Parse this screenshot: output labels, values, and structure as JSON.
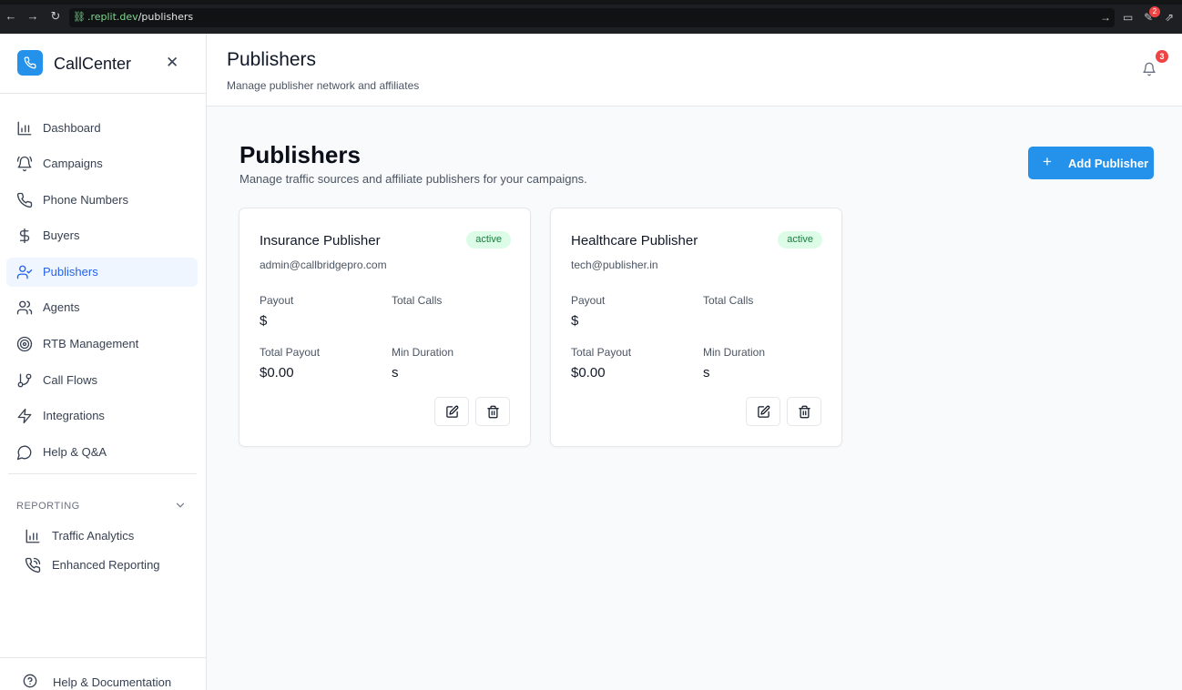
{
  "browser": {
    "url_domain": ".replit.dev",
    "url_path": "/publishers",
    "extension_badge": "2"
  },
  "sidebar": {
    "brand": "CallCenter",
    "close": "✕",
    "items": [
      {
        "label": "Dashboard",
        "icon": "bar-chart-icon"
      },
      {
        "label": "Campaigns",
        "icon": "bell-ring-icon"
      },
      {
        "label": "Phone Numbers",
        "icon": "phone-icon"
      },
      {
        "label": "Buyers",
        "icon": "dollar-icon"
      },
      {
        "label": "Publishers",
        "icon": "user-check-icon",
        "active": true
      },
      {
        "label": "Agents",
        "icon": "users-icon"
      },
      {
        "label": "RTB Management",
        "icon": "target-icon"
      },
      {
        "label": "Call Flows",
        "icon": "git-branch-icon"
      },
      {
        "label": "Integrations",
        "icon": "zap-icon"
      },
      {
        "label": "Help & Q&A",
        "icon": "message-circle-icon"
      }
    ],
    "reporting_label": "REPORTING",
    "reporting_items": [
      {
        "label": "Traffic Analytics",
        "icon": "bar-chart-icon"
      },
      {
        "label": "Enhanced Reporting",
        "icon": "phone-call-icon"
      }
    ],
    "footer_label": "Help & Documentation"
  },
  "header": {
    "title": "Publishers",
    "subtitle": "Manage publisher network and affiliates",
    "notification_count": "3"
  },
  "main": {
    "title": "Publishers",
    "subtitle": "Manage traffic sources and affiliate publishers for your campaigns.",
    "add_button": "Add Publisher",
    "add_button_icon": "+"
  },
  "publishers": [
    {
      "name": "Insurance Publisher",
      "status": "active",
      "email": "admin@callbridgepro.com",
      "payout_label": "Payout",
      "payout_value": "$",
      "total_calls_label": "Total Calls",
      "total_calls_value": "",
      "total_payout_label": "Total Payout",
      "total_payout_value": "$0.00",
      "min_duration_label": "Min Duration",
      "min_duration_value": "s"
    },
    {
      "name": "Healthcare Publisher",
      "status": "active",
      "email": "tech@publisher.in",
      "payout_label": "Payout",
      "payout_value": "$",
      "total_calls_label": "Total Calls",
      "total_calls_value": "",
      "total_payout_label": "Total Payout",
      "total_payout_value": "$0.00",
      "min_duration_label": "Min Duration",
      "min_duration_value": "s"
    }
  ],
  "colors": {
    "accent": "#2491eb",
    "active_badge_bg": "#dcfce7",
    "active_badge_text": "#15803d",
    "notification": "#ef4444"
  }
}
